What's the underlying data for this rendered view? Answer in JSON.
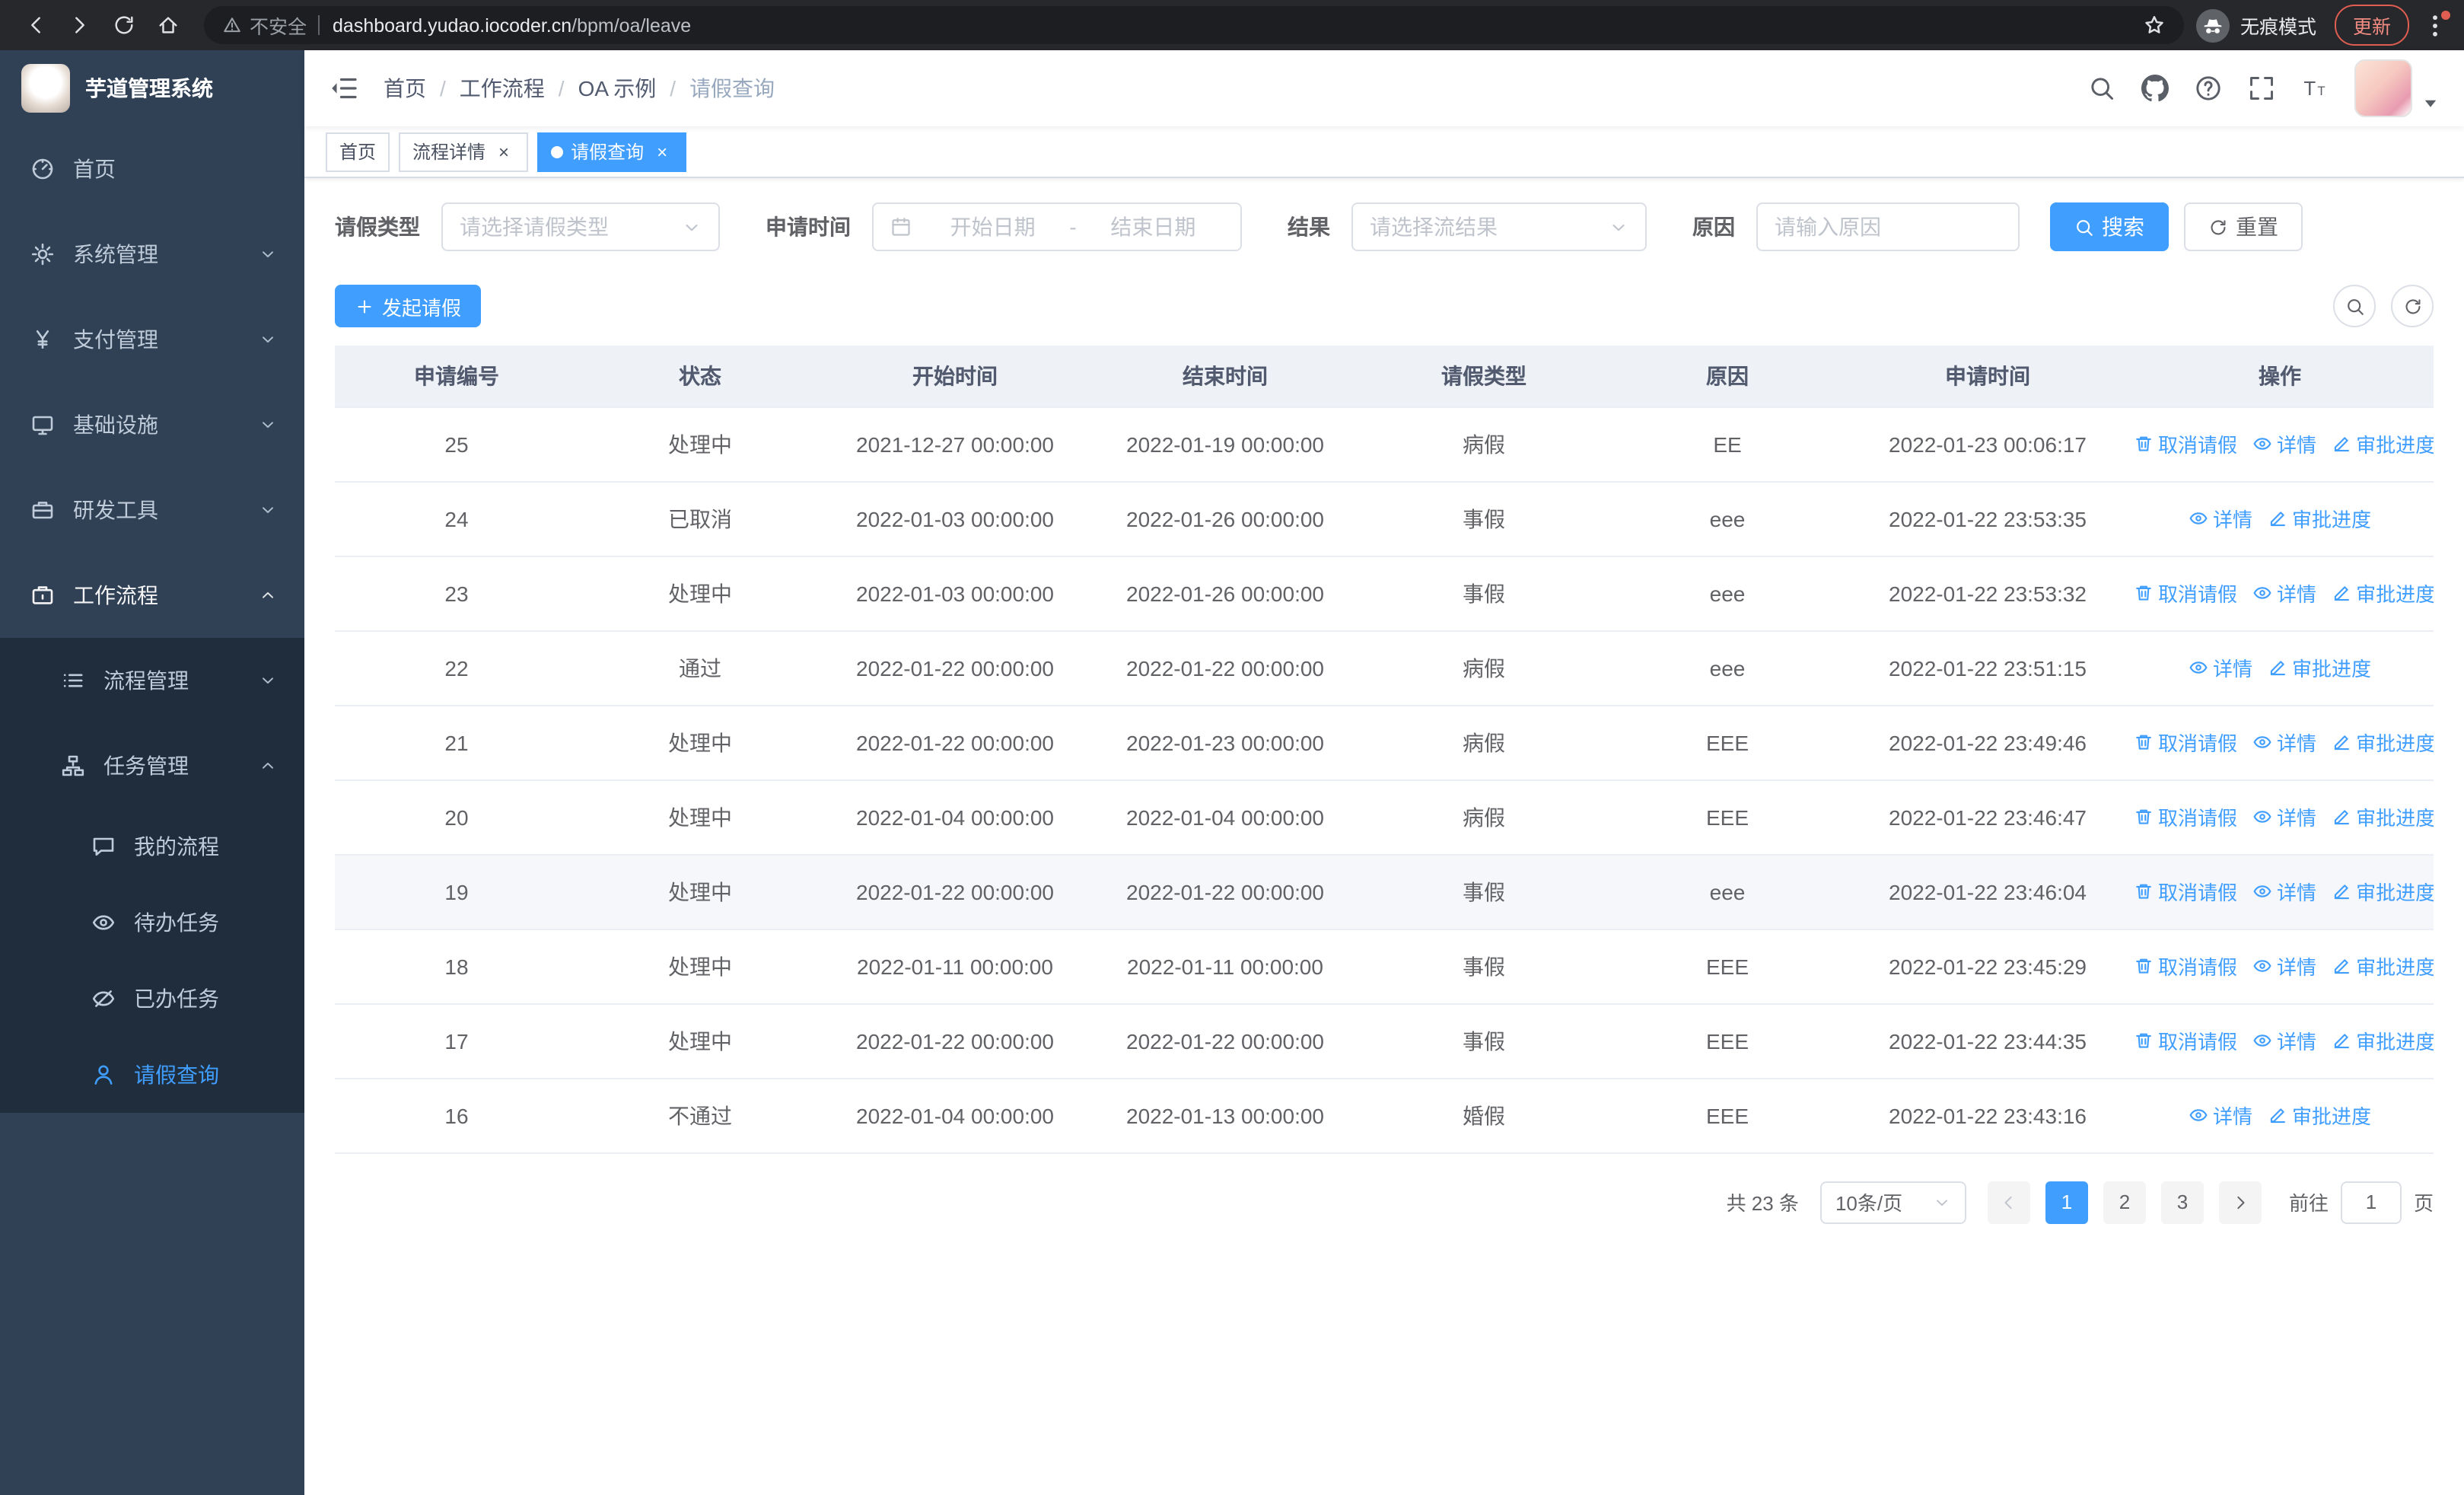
{
  "colors": {
    "primary": "#409eff",
    "sidebar_bg": "#304156",
    "submenu_bg": "#1f2d3d"
  },
  "browser": {
    "security_label": "不安全",
    "url_domain": "dashboard.yudao.iocoder.cn",
    "url_path": "/bpm/oa/leave",
    "incognito_label": "无痕模式",
    "update_label": "更新",
    "nav_icons": [
      "back-icon",
      "forward-icon",
      "reload-icon",
      "home-icon"
    ]
  },
  "sidebar": {
    "title": "芋道管理系统",
    "items": [
      {
        "id": "home",
        "label": "首页",
        "icon": "dashboard-icon",
        "level": 0
      },
      {
        "id": "system",
        "label": "系统管理",
        "icon": "gear-icon",
        "level": 0,
        "chevron": "down"
      },
      {
        "id": "payment",
        "label": "支付管理",
        "icon": "yen-icon",
        "level": 0,
        "chevron": "down"
      },
      {
        "id": "infrastructure",
        "label": "基础设施",
        "icon": "monitor-icon",
        "level": 0,
        "chevron": "down"
      },
      {
        "id": "devtools",
        "label": "研发工具",
        "icon": "toolbox-icon",
        "level": 0,
        "chevron": "down"
      },
      {
        "id": "workflow",
        "label": "工作流程",
        "icon": "briefcase-icon",
        "level": 0,
        "chevron": "up",
        "emphasis": true
      },
      {
        "id": "process-mgmt",
        "label": "流程管理",
        "icon": "list-icon",
        "level": 1,
        "chevron": "down",
        "submenu": true
      },
      {
        "id": "task-mgmt",
        "label": "任务管理",
        "icon": "tree-icon",
        "level": 1,
        "chevron": "up",
        "submenu": true
      },
      {
        "id": "my-process",
        "label": "我的流程",
        "icon": "chat-icon",
        "level": 2,
        "submenu": true
      },
      {
        "id": "todo-task",
        "label": "待办任务",
        "icon": "eye-icon",
        "level": 2,
        "submenu": true
      },
      {
        "id": "done-task",
        "label": "已办任务",
        "icon": "eye-off-icon",
        "level": 2,
        "submenu": true
      },
      {
        "id": "leave-query",
        "label": "请假查询",
        "icon": "user-icon",
        "level": 2,
        "submenu": true,
        "active": true
      }
    ]
  },
  "navbar": {
    "breadcrumb": [
      "首页",
      "工作流程",
      "OA 示例",
      "请假查询"
    ],
    "icons": [
      "search-icon",
      "github-icon",
      "question-icon",
      "fullscreen-icon",
      "font-size-icon"
    ]
  },
  "tabs": [
    {
      "id": "home",
      "label": "首页",
      "closable": false,
      "active": false
    },
    {
      "id": "process-detail",
      "label": "流程详情",
      "closable": true,
      "active": false
    },
    {
      "id": "leave-query",
      "label": "请假查询",
      "closable": true,
      "active": true
    }
  ],
  "filters": {
    "leave_type_label": "请假类型",
    "leave_type_placeholder": "请选择请假类型",
    "apply_time_label": "申请时间",
    "start_date_placeholder": "开始日期",
    "range_separator": "-",
    "end_date_placeholder": "结束日期",
    "result_label": "结果",
    "result_placeholder": "请选择流结果",
    "reason_label": "原因",
    "reason_placeholder": "请输入原因",
    "search_button": "搜索",
    "reset_button": "重置"
  },
  "toolbar": {
    "create_button": "发起请假",
    "right_icons": [
      "search-icon",
      "refresh-icon"
    ]
  },
  "table": {
    "columns": [
      "申请编号",
      "状态",
      "开始时间",
      "结束时间",
      "请假类型",
      "原因",
      "申请时间",
      "操作"
    ],
    "action_labels": {
      "cancel": "取消请假",
      "detail": "详情",
      "progress": "审批进度"
    },
    "rows": [
      {
        "id": "25",
        "status": "处理中",
        "start": "2021-12-27 00:00:00",
        "end": "2022-01-19 00:00:00",
        "type": "病假",
        "reason": "EE",
        "applied": "2022-01-23 00:06:17",
        "actions": [
          "cancel",
          "detail",
          "progress"
        ]
      },
      {
        "id": "24",
        "status": "已取消",
        "start": "2022-01-03 00:00:00",
        "end": "2022-01-26 00:00:00",
        "type": "事假",
        "reason": "eee",
        "applied": "2022-01-22 23:53:35",
        "actions": [
          "detail",
          "progress"
        ]
      },
      {
        "id": "23",
        "status": "处理中",
        "start": "2022-01-03 00:00:00",
        "end": "2022-01-26 00:00:00",
        "type": "事假",
        "reason": "eee",
        "applied": "2022-01-22 23:53:32",
        "actions": [
          "cancel",
          "detail",
          "progress"
        ]
      },
      {
        "id": "22",
        "status": "通过",
        "start": "2022-01-22 00:00:00",
        "end": "2022-01-22 00:00:00",
        "type": "病假",
        "reason": "eee",
        "applied": "2022-01-22 23:51:15",
        "actions": [
          "detail",
          "progress"
        ]
      },
      {
        "id": "21",
        "status": "处理中",
        "start": "2022-01-22 00:00:00",
        "end": "2022-01-23 00:00:00",
        "type": "病假",
        "reason": "EEE",
        "applied": "2022-01-22 23:49:46",
        "actions": [
          "cancel",
          "detail",
          "progress"
        ]
      },
      {
        "id": "20",
        "status": "处理中",
        "start": "2022-01-04 00:00:00",
        "end": "2022-01-04 00:00:00",
        "type": "病假",
        "reason": "EEE",
        "applied": "2022-01-22 23:46:47",
        "actions": [
          "cancel",
          "detail",
          "progress"
        ]
      },
      {
        "id": "19",
        "status": "处理中",
        "start": "2022-01-22 00:00:00",
        "end": "2022-01-22 00:00:00",
        "type": "事假",
        "reason": "eee",
        "applied": "2022-01-22 23:46:04",
        "actions": [
          "cancel",
          "detail",
          "progress"
        ],
        "highlight": true
      },
      {
        "id": "18",
        "status": "处理中",
        "start": "2022-01-11 00:00:00",
        "end": "2022-01-11 00:00:00",
        "type": "事假",
        "reason": "EEE",
        "applied": "2022-01-22 23:45:29",
        "actions": [
          "cancel",
          "detail",
          "progress"
        ]
      },
      {
        "id": "17",
        "status": "处理中",
        "start": "2022-01-22 00:00:00",
        "end": "2022-01-22 00:00:00",
        "type": "事假",
        "reason": "EEE",
        "applied": "2022-01-22 23:44:35",
        "actions": [
          "cancel",
          "detail",
          "progress"
        ]
      },
      {
        "id": "16",
        "status": "不通过",
        "start": "2022-01-04 00:00:00",
        "end": "2022-01-13 00:00:00",
        "type": "婚假",
        "reason": "EEE",
        "applied": "2022-01-22 23:43:16",
        "actions": [
          "detail",
          "progress"
        ]
      }
    ]
  },
  "pagination": {
    "total_label": "共 23 条",
    "page_size": "10条/页",
    "pages": [
      "1",
      "2",
      "3"
    ],
    "active_page": "1",
    "goto_label": "前往",
    "goto_value": "1",
    "goto_suffix": "页"
  }
}
